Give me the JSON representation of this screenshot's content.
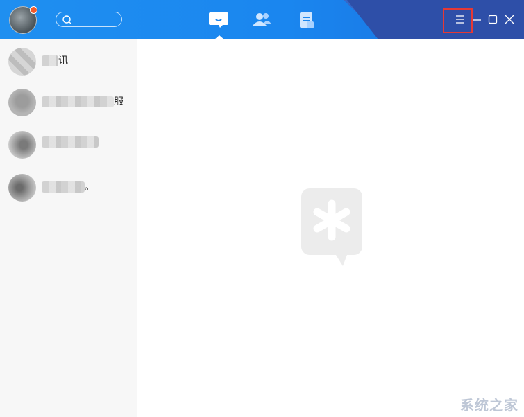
{
  "header": {
    "nav": [
      {
        "icon": "chat-bubble-icon",
        "active": true
      },
      {
        "icon": "contacts-icon",
        "active": false
      },
      {
        "icon": "document-icon",
        "active": false
      }
    ],
    "window_controls": [
      "menu-icon",
      "minimize-icon",
      "maximize-icon",
      "close-icon"
    ]
  },
  "sidebar": {
    "chats": [
      {
        "name_suffix": "讯"
      },
      {
        "name_suffix": "服"
      },
      {
        "name_suffix": ""
      },
      {
        "name_suffix": "。"
      }
    ]
  },
  "watermark": {
    "text": "系统之家"
  },
  "colors": {
    "accent": "#1a86ef",
    "header_dark": "#2e4fa8",
    "highlight": "#e53935"
  }
}
